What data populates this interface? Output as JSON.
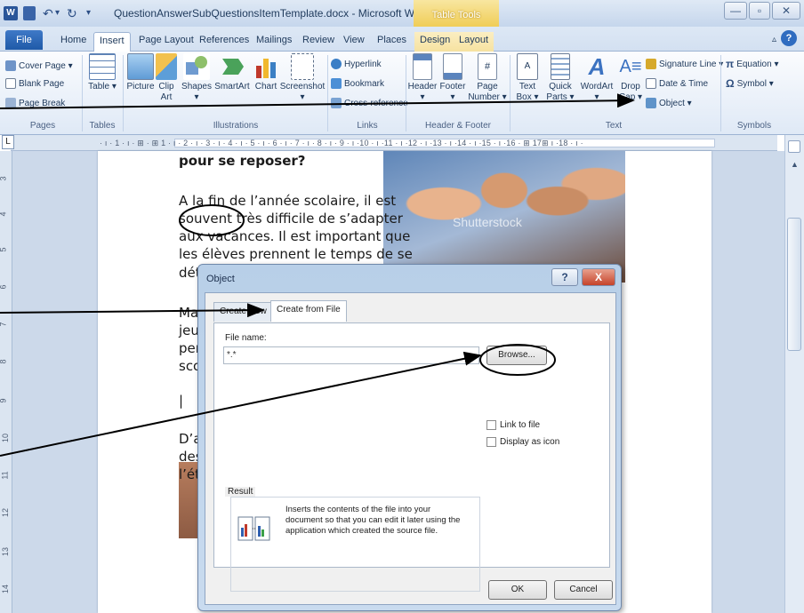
{
  "titlebar": {
    "app_icon": "W",
    "title": "QuestionAnswerSubQuestionsItemTemplate.docx - Microsoft Word",
    "context_tab_group": "Table Tools",
    "minimize": "—",
    "maximize": "▫",
    "close": "✕"
  },
  "tabs": {
    "file": "File",
    "items": [
      "Home",
      "Insert",
      "Page Layout",
      "References",
      "Mailings",
      "Review",
      "View",
      "Places",
      "Design",
      "Layout"
    ],
    "active": "Insert",
    "minimize_ribbon": "▵",
    "help": "?"
  },
  "ribbon": {
    "pages": {
      "label": "Pages",
      "items": [
        "Cover Page ▾",
        "Blank Page",
        "Page Break"
      ]
    },
    "tables": {
      "label": "Tables",
      "items": [
        "Table ▾"
      ]
    },
    "illustrations": {
      "label": "Illustrations",
      "items": [
        "Picture",
        "Clip Art",
        "Shapes ▾",
        "SmartArt",
        "Chart",
        "Screenshot ▾"
      ]
    },
    "links": {
      "label": "Links",
      "items": [
        "Hyperlink",
        "Bookmark",
        "Cross-reference"
      ]
    },
    "header_footer": {
      "label": "Header & Footer",
      "items": [
        "Header ▾",
        "Footer ▾",
        "Page Number ▾"
      ]
    },
    "text": {
      "label": "Text",
      "items": [
        "Text Box ▾",
        "Quick Parts ▾",
        "WordArt ▾",
        "Drop Cap ▾"
      ],
      "small_items": [
        "Signature Line ▾",
        "Date & Time",
        "Object ▾"
      ]
    },
    "symbols": {
      "label": "Symbols",
      "items": [
        "Equation ▾",
        "Symbol ▾"
      ]
    }
  },
  "ruler": {
    "corner": "L",
    "horizontal": "· ı · 1 · ı · ⊞ · ⊞ 1 · ı · 2 · ı · 3 · ı · 4 · ı · 5 · ı · 6 · ı · 7 · ı · 8 · ı · 9 · ı ·10 · ı ·11 · ı ·12 · ı ·13 · ı ·14 · ı ·15 · ı ·16 · ⊞ 17⊞ ı ·18 · ı ·",
    "vertical": [
      "3",
      "4",
      "5",
      "6",
      "7",
      "8",
      "9",
      "10",
      "11",
      "12",
      "13",
      "14"
    ]
  },
  "document": {
    "lines": [
      "pour se reposer?",
      "A la fin de l’année scolaire, il est",
      "souvent très difficile de  s’adapter",
      "aux vacances. Il est important que",
      "les élèves prennent le temps de se",
      "dét",
      "Mai",
      "jeu",
      "pen",
      "sco",
      "|",
      "D’a",
      "des",
      "l’ét"
    ],
    "photo_watermark": "Shutterstock"
  },
  "dialog": {
    "title": "Object",
    "help_glyph": "?",
    "close_glyph": "X",
    "tabs": [
      "Create New",
      "Create from File"
    ],
    "active_tab": "Create from File",
    "file_name_label": "File name:",
    "file_name_value": "*.*",
    "browse_button": "Browse...",
    "link_to_file": "Link to file",
    "display_as_icon": "Display as icon",
    "result_label": "Result",
    "result_text": "Inserts the contents of the file into your document so that you can edit it later using the application which created the source file.",
    "ok_button": "OK",
    "cancel_button": "Cancel"
  }
}
